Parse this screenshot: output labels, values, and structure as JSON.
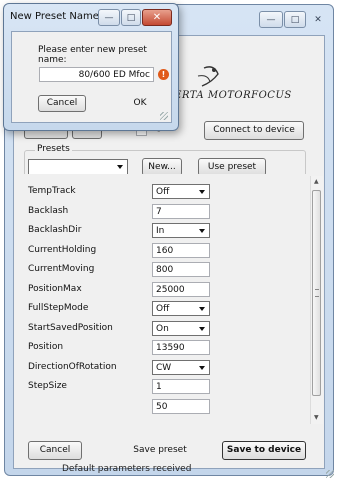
{
  "main": {
    "window_buttons": [
      "minimize-icon",
      "restore-icon",
      "close-icon"
    ],
    "logo_text": "CERTA  MOTORFOCUS",
    "top_row": {
      "connect_button": "Connect to device"
    },
    "presets": {
      "group_label": "Presets",
      "select_value": "",
      "new_button": "New...",
      "use_button": "Use preset"
    },
    "parameters": [
      {
        "label": "TempTrack",
        "value": "Off",
        "kind": "select"
      },
      {
        "label": "Backlash",
        "value": "7",
        "kind": "input"
      },
      {
        "label": "BacklashDir",
        "value": "In",
        "kind": "select"
      },
      {
        "label": "CurrentHolding",
        "value": "160",
        "kind": "input"
      },
      {
        "label": "CurrentMoving",
        "value": "800",
        "kind": "input"
      },
      {
        "label": "PositionMax",
        "value": "25000",
        "kind": "input"
      },
      {
        "label": "FullStepMode",
        "value": "Off",
        "kind": "select"
      },
      {
        "label": "StartSavedPosition",
        "value": "On",
        "kind": "select"
      },
      {
        "label": "Position",
        "value": "13590",
        "kind": "input"
      },
      {
        "label": "DirectionOfRotation",
        "value": "CW",
        "kind": "select"
      },
      {
        "label": "StepSize",
        "value": "1",
        "kind": "input"
      },
      {
        "label": "",
        "value": "50",
        "kind": "input"
      }
    ],
    "footer": {
      "cancel": "Cancel",
      "save_preset": "Save preset",
      "save_device": "Save to device"
    },
    "status": "Default parameters received"
  },
  "dialog": {
    "title": "New Preset Name",
    "prompt": "Please enter new preset name:",
    "input_value": "80/600 ED Mfoc",
    "cancel": "Cancel",
    "ok": "OK"
  },
  "colors": {
    "title_gradient_top": "#d6e4f4",
    "client_bg": "#f0f0f0",
    "close_red": "#c44a33",
    "error_orange": "#e05a1a"
  }
}
